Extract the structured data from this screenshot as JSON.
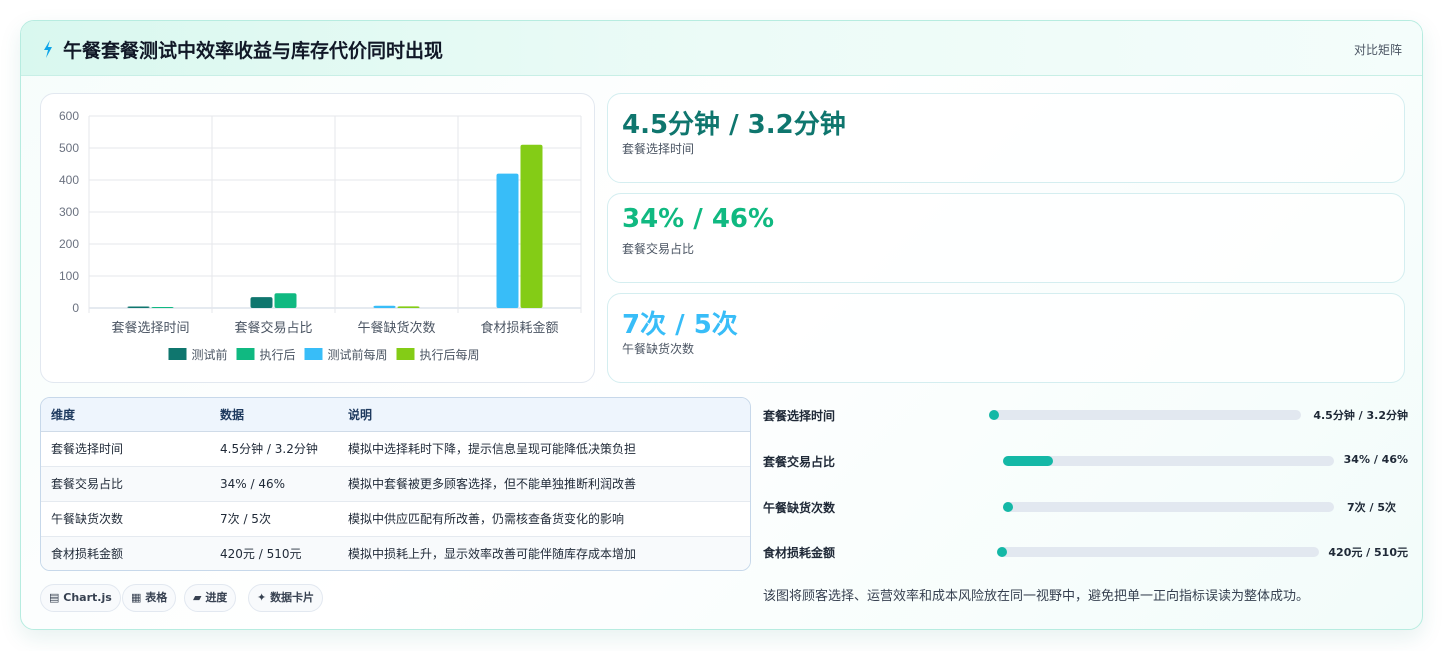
{
  "header": {
    "title": "午餐套餐测试中效率收益与库存代价同时出现",
    "link": "对比矩阵",
    "icon": "lightning-icon"
  },
  "chart_data": {
    "type": "bar",
    "categories": [
      "套餐选择时间",
      "套餐交易占比",
      "午餐缺货次数",
      "食材损耗金额"
    ],
    "series": [
      {
        "name": "测试前",
        "color": "#0f766e",
        "values": [
          4.5,
          34,
          null,
          null
        ]
      },
      {
        "name": "执行后",
        "color": "#10b981",
        "values": [
          3.2,
          46,
          null,
          null
        ]
      },
      {
        "name": "测试前每周",
        "color": "#38bdf8",
        "values": [
          null,
          null,
          7,
          420
        ]
      },
      {
        "name": "执行后每周",
        "color": "#84cc16",
        "values": [
          null,
          null,
          5,
          510
        ]
      }
    ],
    "yticks": [
      0,
      100,
      200,
      300,
      400,
      500,
      600
    ],
    "ylim": [
      0,
      600
    ],
    "legend_position": "bottom",
    "grid": true
  },
  "kpis": [
    {
      "value": "4.5分钟 / 3.2分钟",
      "label": "套餐选择时间",
      "color": "#0f766e"
    },
    {
      "value": "34% / 46%",
      "label": "套餐交易占比",
      "color": "#10b981"
    },
    {
      "value": "7次 / 5次",
      "label": "午餐缺货次数",
      "color": "#38bdf8"
    }
  ],
  "table": {
    "headers": [
      "维度",
      "数据",
      "说明"
    ],
    "rows": [
      [
        "套餐选择时间",
        "4.5分钟 / 3.2分钟",
        "模拟中选择耗时下降，提示信息呈现可能降低决策负担"
      ],
      [
        "套餐交易占比",
        "34% / 46%",
        "模拟中套餐被更多顾客选择，但不能单独推断利润改善"
      ],
      [
        "午餐缺货次数",
        "7次 / 5次",
        "模拟中供应匹配有所改善，仍需核查备货变化的影响"
      ],
      [
        "食材损耗金额",
        "420元 / 510元",
        "模拟中损耗上升，显示效率改善可能伴随库存成本增加"
      ]
    ]
  },
  "tags": [
    {
      "icon": "chart-icon",
      "glyph": "▤",
      "label": "Chart.js"
    },
    {
      "icon": "table-icon",
      "glyph": "▦",
      "label": "表格"
    },
    {
      "icon": "progress-icon",
      "glyph": "▰",
      "label": "进度"
    },
    {
      "icon": "sparkle-icon",
      "glyph": "✦",
      "label": "数据卡片"
    }
  ],
  "progress": [
    {
      "label": "套餐选择时间",
      "value": "4.5分钟 / 3.2分钟",
      "fraction": 0.0
    },
    {
      "label": "套餐交易占比",
      "value": "34% / 46%",
      "fraction": 0.15
    },
    {
      "label": "午餐缺货次数",
      "value": "7次 / 5次",
      "fraction": 0.0
    },
    {
      "label": "食材损耗金额",
      "value": "420元 / 510元",
      "fraction": 0.0
    }
  ],
  "note": "该图将顾客选择、运营效率和成本风险放在同一视野中，避免把单一正向指标误读为整体成功。"
}
